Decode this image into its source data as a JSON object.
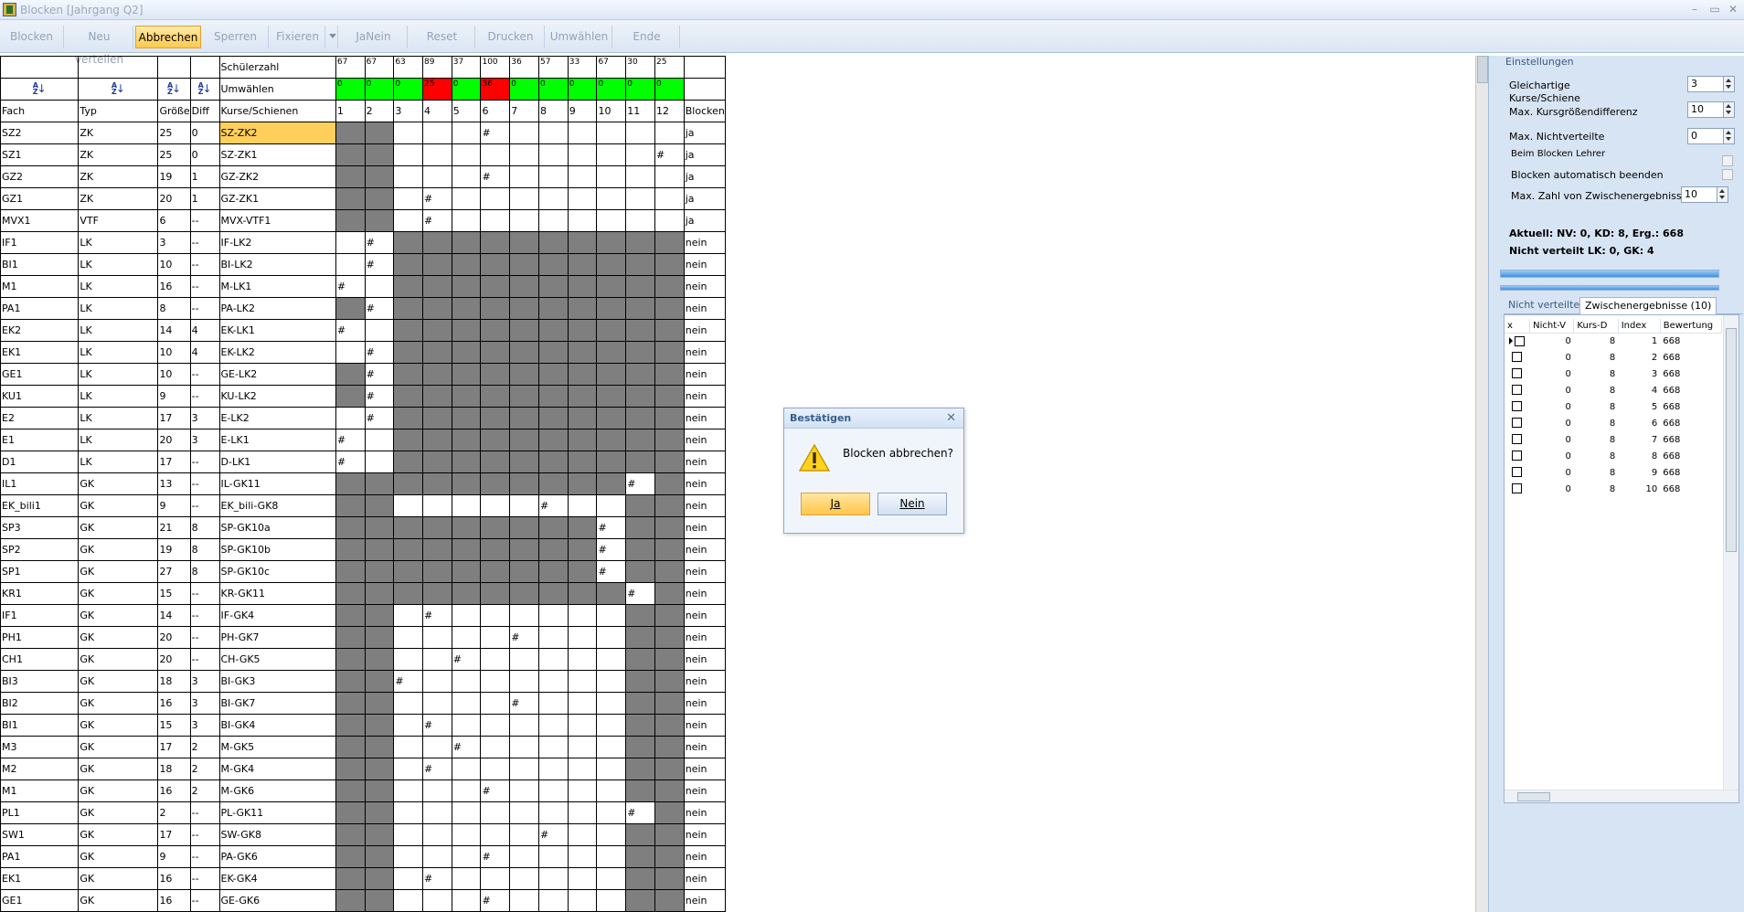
{
  "window": {
    "title": "Blocken [Jahrgang Q2]"
  },
  "toolbar": {
    "buttons": [
      "Blocken",
      "Neu verteilen",
      "Abbrechen",
      "Sperren",
      "Fixieren",
      "JaNein",
      "Reset",
      "Drucken",
      "Umwählen",
      "Ende"
    ],
    "active": "Abbrechen"
  },
  "grid": {
    "header": {
      "schuelerzahl_label": "Schülerzahl",
      "umwaehlen_label": "Umwählen",
      "schuelerzahl": [
        "67",
        "67",
        "63",
        "89",
        "37",
        "100",
        "36",
        "57",
        "33",
        "67",
        "30",
        "25"
      ],
      "umwaehlen": [
        "0",
        "0",
        "0",
        "25",
        "0",
        "36",
        "0",
        "0",
        "0",
        "0",
        "0",
        "0"
      ],
      "umwaehlen_colors": [
        "green",
        "green",
        "green",
        "red",
        "green",
        "red",
        "green",
        "green",
        "green",
        "green",
        "green",
        "green"
      ],
      "columns": [
        "Fach",
        "Typ",
        "Größe",
        "Diff",
        "Kurse/Schienen",
        "1",
        "2",
        "3",
        "4",
        "5",
        "6",
        "7",
        "8",
        "9",
        "10",
        "11",
        "12",
        "Blocken"
      ]
    },
    "rows": [
      {
        "fach": "SZ2",
        "typ": "ZK",
        "groesse": "25",
        "diff": "0",
        "kurs": "SZ-ZK2",
        "mark": 6,
        "gray": [
          1,
          2
        ],
        "blocken": "ja"
      },
      {
        "fach": "SZ1",
        "typ": "ZK",
        "groesse": "25",
        "diff": "0",
        "kurs": "SZ-ZK1",
        "mark": 12,
        "gray": [
          1,
          2
        ],
        "blocken": "ja"
      },
      {
        "fach": "GZ2",
        "typ": "ZK",
        "groesse": "19",
        "diff": "1",
        "kurs": "GZ-ZK2",
        "mark": 6,
        "gray": [
          1,
          2
        ],
        "blocken": "ja"
      },
      {
        "fach": "GZ1",
        "typ": "ZK",
        "groesse": "20",
        "diff": "1",
        "kurs": "GZ-ZK1",
        "mark": 4,
        "gray": [
          1,
          2
        ],
        "blocken": "ja"
      },
      {
        "fach": "MVX1",
        "typ": "VTF",
        "groesse": "6",
        "diff": "--",
        "kurs": "MVX-VTF1",
        "mark": 4,
        "gray": [
          1,
          2
        ],
        "blocken": "ja"
      },
      {
        "fach": "IF1",
        "typ": "LK",
        "groesse": "3",
        "diff": "--",
        "kurs": "IF-LK2",
        "mark": 2,
        "gray": [
          3,
          4,
          5,
          6,
          7,
          8,
          9,
          10,
          11,
          12
        ],
        "blocken": "nein"
      },
      {
        "fach": "BI1",
        "typ": "LK",
        "groesse": "10",
        "diff": "--",
        "kurs": "BI-LK2",
        "mark": 2,
        "gray": [
          3,
          4,
          5,
          6,
          7,
          8,
          9,
          10,
          11,
          12
        ],
        "blocken": "nein"
      },
      {
        "fach": "M1",
        "typ": "LK",
        "groesse": "16",
        "diff": "--",
        "kurs": "M-LK1",
        "mark": 1,
        "gray": [
          3,
          4,
          5,
          6,
          7,
          8,
          9,
          10,
          11,
          12
        ],
        "blocken": "nein"
      },
      {
        "fach": "PA1",
        "typ": "LK",
        "groesse": "8",
        "diff": "--",
        "kurs": "PA-LK2",
        "mark": 2,
        "gray": [
          1,
          3,
          4,
          5,
          6,
          7,
          8,
          9,
          10,
          11,
          12
        ],
        "blocken": "nein"
      },
      {
        "fach": "EK2",
        "typ": "LK",
        "groesse": "14",
        "diff": "4",
        "kurs": "EK-LK1",
        "mark": 1,
        "gray": [
          3,
          4,
          5,
          6,
          7,
          8,
          9,
          10,
          11,
          12
        ],
        "blocken": "nein"
      },
      {
        "fach": "EK1",
        "typ": "LK",
        "groesse": "10",
        "diff": "4",
        "kurs": "EK-LK2",
        "mark": 2,
        "gray": [
          3,
          4,
          5,
          6,
          7,
          8,
          9,
          10,
          11,
          12
        ],
        "blocken": "nein"
      },
      {
        "fach": "GE1",
        "typ": "LK",
        "groesse": "10",
        "diff": "--",
        "kurs": "GE-LK2",
        "mark": 2,
        "gray": [
          1,
          3,
          4,
          5,
          6,
          7,
          8,
          9,
          10,
          11,
          12
        ],
        "blocken": "nein"
      },
      {
        "fach": "KU1",
        "typ": "LK",
        "groesse": "9",
        "diff": "--",
        "kurs": "KU-LK2",
        "mark": 2,
        "gray": [
          1,
          3,
          4,
          5,
          6,
          7,
          8,
          9,
          10,
          11,
          12
        ],
        "blocken": "nein"
      },
      {
        "fach": "E2",
        "typ": "LK",
        "groesse": "17",
        "diff": "3",
        "kurs": "E-LK2",
        "mark": 2,
        "gray": [
          3,
          4,
          5,
          6,
          7,
          8,
          9,
          10,
          11,
          12
        ],
        "blocken": "nein"
      },
      {
        "fach": "E1",
        "typ": "LK",
        "groesse": "20",
        "diff": "3",
        "kurs": "E-LK1",
        "mark": 1,
        "gray": [
          3,
          4,
          5,
          6,
          7,
          8,
          9,
          10,
          11,
          12
        ],
        "blocken": "nein"
      },
      {
        "fach": "D1",
        "typ": "LK",
        "groesse": "17",
        "diff": "--",
        "kurs": "D-LK1",
        "mark": 1,
        "gray": [
          3,
          4,
          5,
          6,
          7,
          8,
          9,
          10,
          11,
          12
        ],
        "blocken": "nein"
      },
      {
        "fach": "IL1",
        "typ": "GK",
        "groesse": "13",
        "diff": "--",
        "kurs": "IL-GK11",
        "mark": 11,
        "gray": [
          1,
          2,
          3,
          4,
          5,
          6,
          7,
          8,
          9,
          10,
          12
        ],
        "blocken": "nein"
      },
      {
        "fach": "EK_bili1",
        "typ": "GK",
        "groesse": "9",
        "diff": "--",
        "kurs": "EK_bili-GK8",
        "mark": 8,
        "gray": [
          1,
          2,
          11,
          12
        ],
        "blocken": "nein"
      },
      {
        "fach": "SP3",
        "typ": "GK",
        "groesse": "21",
        "diff": "8",
        "kurs": "SP-GK10a",
        "mark": 10,
        "gray": [
          1,
          2,
          3,
          4,
          5,
          6,
          7,
          8,
          9,
          11,
          12
        ],
        "blocken": "nein"
      },
      {
        "fach": "SP2",
        "typ": "GK",
        "groesse": "19",
        "diff": "8",
        "kurs": "SP-GK10b",
        "mark": 10,
        "gray": [
          1,
          2,
          3,
          4,
          5,
          6,
          7,
          8,
          9,
          11,
          12
        ],
        "blocken": "nein"
      },
      {
        "fach": "SP1",
        "typ": "GK",
        "groesse": "27",
        "diff": "8",
        "kurs": "SP-GK10c",
        "mark": 10,
        "gray": [
          1,
          2,
          3,
          4,
          5,
          6,
          7,
          8,
          9,
          11,
          12
        ],
        "blocken": "nein"
      },
      {
        "fach": "KR1",
        "typ": "GK",
        "groesse": "15",
        "diff": "--",
        "kurs": "KR-GK11",
        "mark": 11,
        "gray": [
          1,
          2,
          3,
          4,
          5,
          6,
          7,
          8,
          9,
          10,
          12
        ],
        "blocken": "nein"
      },
      {
        "fach": "IF1",
        "typ": "GK",
        "groesse": "14",
        "diff": "--",
        "kurs": "IF-GK4",
        "mark": 4,
        "gray": [
          1,
          2,
          11,
          12
        ],
        "blocken": "nein"
      },
      {
        "fach": "PH1",
        "typ": "GK",
        "groesse": "20",
        "diff": "--",
        "kurs": "PH-GK7",
        "mark": 7,
        "gray": [
          1,
          2,
          11,
          12
        ],
        "blocken": "nein"
      },
      {
        "fach": "CH1",
        "typ": "GK",
        "groesse": "20",
        "diff": "--",
        "kurs": "CH-GK5",
        "mark": 5,
        "gray": [
          1,
          2,
          11,
          12
        ],
        "blocken": "nein"
      },
      {
        "fach": "BI3",
        "typ": "GK",
        "groesse": "18",
        "diff": "3",
        "kurs": "BI-GK3",
        "mark": 3,
        "gray": [
          1,
          2,
          11,
          12
        ],
        "blocken": "nein"
      },
      {
        "fach": "BI2",
        "typ": "GK",
        "groesse": "16",
        "diff": "3",
        "kurs": "BI-GK7",
        "mark": 7,
        "gray": [
          1,
          2,
          11,
          12
        ],
        "blocken": "nein"
      },
      {
        "fach": "BI1",
        "typ": "GK",
        "groesse": "15",
        "diff": "3",
        "kurs": "BI-GK4",
        "mark": 4,
        "gray": [
          1,
          2,
          11,
          12
        ],
        "blocken": "nein"
      },
      {
        "fach": "M3",
        "typ": "GK",
        "groesse": "17",
        "diff": "2",
        "kurs": "M-GK5",
        "mark": 5,
        "gray": [
          1,
          2,
          11,
          12
        ],
        "blocken": "nein"
      },
      {
        "fach": "M2",
        "typ": "GK",
        "groesse": "18",
        "diff": "2",
        "kurs": "M-GK4",
        "mark": 4,
        "gray": [
          1,
          2,
          11,
          12
        ],
        "blocken": "nein"
      },
      {
        "fach": "M1",
        "typ": "GK",
        "groesse": "16",
        "diff": "2",
        "kurs": "M-GK6",
        "mark": 6,
        "gray": [
          1,
          2,
          11,
          12
        ],
        "blocken": "nein"
      },
      {
        "fach": "PL1",
        "typ": "GK",
        "groesse": "2",
        "diff": "--",
        "kurs": "PL-GK11",
        "mark": 11,
        "gray": [
          1,
          2,
          12
        ],
        "blocken": "nein"
      },
      {
        "fach": "SW1",
        "typ": "GK",
        "groesse": "17",
        "diff": "--",
        "kurs": "SW-GK8",
        "mark": 8,
        "gray": [
          1,
          2,
          11,
          12
        ],
        "blocken": "nein"
      },
      {
        "fach": "PA1",
        "typ": "GK",
        "groesse": "9",
        "diff": "--",
        "kurs": "PA-GK6",
        "mark": 6,
        "gray": [
          1,
          2,
          11,
          12
        ],
        "blocken": "nein"
      },
      {
        "fach": "EK1",
        "typ": "GK",
        "groesse": "16",
        "diff": "--",
        "kurs": "EK-GK4",
        "mark": 4,
        "gray": [
          1,
          2,
          11,
          12
        ],
        "blocken": "nein"
      },
      {
        "fach": "GE1",
        "typ": "GK",
        "groesse": "16",
        "diff": "--",
        "kurs": "GE-GK6",
        "mark": 6,
        "gray": [
          1,
          2,
          11,
          12
        ],
        "blocken": "nein"
      }
    ],
    "mark_symbol": "#"
  },
  "settings": {
    "title": "Einstellungen",
    "gleichartige_label": "Gleichartige",
    "gleichartige_label2": "Kurse/Schiene",
    "gleichartige_value": "3",
    "max_diff_label": "Max. Kursgrößendifferenz",
    "max_diff_value": "10",
    "max_nicht_label": "Max. Nichtverteilte",
    "max_nicht_value": "0",
    "lehrer_label": "Beim Blocken Lehrer berücksichtigen",
    "auto_label": "Blocken automatisch beenden",
    "max_zwischen_label": "Max. Zahl von Zwischenergebnissen",
    "max_zwischen_value": "10",
    "aktuell": "Aktuell: NV: 0, KD: 8, Erg.: 668",
    "nicht_verteilt": "Nicht verteilt LK: 0, GK: 4"
  },
  "tabs": [
    "Nicht verteilte",
    "Zwischenergebnisse (10)"
  ],
  "results": {
    "columns": [
      "x",
      "Nicht-V",
      "Kurs-D",
      "Index",
      "Bewertung"
    ],
    "rows": [
      [
        "0",
        "8",
        "1",
        "668"
      ],
      [
        "0",
        "8",
        "2",
        "668"
      ],
      [
        "0",
        "8",
        "3",
        "668"
      ],
      [
        "0",
        "8",
        "4",
        "668"
      ],
      [
        "0",
        "8",
        "5",
        "668"
      ],
      [
        "0",
        "8",
        "6",
        "668"
      ],
      [
        "0",
        "8",
        "7",
        "668"
      ],
      [
        "0",
        "8",
        "8",
        "668"
      ],
      [
        "0",
        "8",
        "9",
        "668"
      ],
      [
        "0",
        "8",
        "10",
        "668"
      ]
    ]
  },
  "dialog": {
    "title": "Bestätigen",
    "message": "Blocken abbrechen?",
    "yes": "Ja",
    "no": "Nein"
  },
  "icons": {
    "close": "close-icon",
    "warning": "warning-icon"
  }
}
